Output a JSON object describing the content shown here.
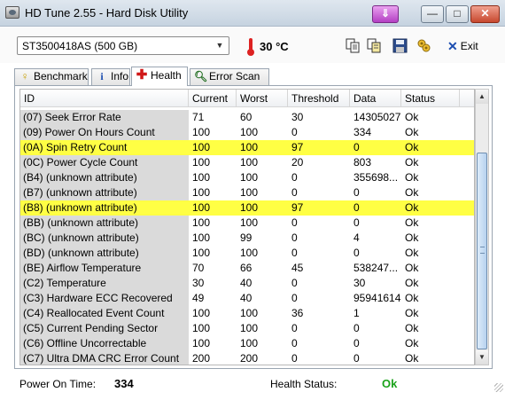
{
  "window": {
    "title": "HD Tune 2.55 - Hard Disk Utility",
    "controls": {
      "download": "⇓",
      "minimize": "—",
      "maximize": "□",
      "close": "✕"
    }
  },
  "toolbar": {
    "drive": "ST3500418AS (500 GB)",
    "temperature": "30 °C",
    "exit_label": "Exit",
    "icons": [
      "copy-icon",
      "copy-all-icon",
      "save-icon",
      "options-icon",
      "exit-icon"
    ]
  },
  "tabs": [
    {
      "label": "Benchmark",
      "icon": "gauge-icon",
      "active": false
    },
    {
      "label": "Info",
      "icon": "info-icon",
      "active": false
    },
    {
      "label": "Health",
      "icon": "health-cross-icon",
      "active": true
    },
    {
      "label": "Error Scan",
      "icon": "magnifier-icon",
      "active": false
    }
  ],
  "table": {
    "columns": [
      "ID",
      "Current",
      "Worst",
      "Threshold",
      "Data",
      "Status"
    ],
    "rows": [
      [
        "(07) Seek Error Rate",
        "71",
        "60",
        "30",
        "14305027",
        "Ok"
      ],
      [
        "(09) Power On Hours Count",
        "100",
        "100",
        "0",
        "334",
        "Ok"
      ],
      [
        "(0A) Spin Retry Count",
        "100",
        "100",
        "97",
        "0",
        "Ok"
      ],
      [
        "(0C) Power Cycle Count",
        "100",
        "100",
        "20",
        "803",
        "Ok"
      ],
      [
        "(B4) (unknown attribute)",
        "100",
        "100",
        "0",
        "355698...",
        "Ok"
      ],
      [
        "(B7) (unknown attribute)",
        "100",
        "100",
        "0",
        "0",
        "Ok"
      ],
      [
        "(B8) (unknown attribute)",
        "100",
        "100",
        "97",
        "0",
        "Ok"
      ],
      [
        "(BB) (unknown attribute)",
        "100",
        "100",
        "0",
        "0",
        "Ok"
      ],
      [
        "(BC) (unknown attribute)",
        "100",
        "99",
        "0",
        "4",
        "Ok"
      ],
      [
        "(BD) (unknown attribute)",
        "100",
        "100",
        "0",
        "0",
        "Ok"
      ],
      [
        "(BE) Airflow Temperature",
        "70",
        "66",
        "45",
        "538247...",
        "Ok"
      ],
      [
        "(C2) Temperature",
        "30",
        "40",
        "0",
        "30",
        "Ok"
      ],
      [
        "(C3) Hardware ECC Recovered",
        "49",
        "40",
        "0",
        "95941614",
        "Ok"
      ],
      [
        "(C4) Reallocated Event Count",
        "100",
        "100",
        "36",
        "1",
        "Ok"
      ],
      [
        "(C5) Current Pending Sector",
        "100",
        "100",
        "0",
        "0",
        "Ok"
      ],
      [
        "(C6) Offline Uncorrectable",
        "100",
        "100",
        "0",
        "0",
        "Ok"
      ],
      [
        "(C7) Ultra DMA CRC Error Count",
        "200",
        "200",
        "0",
        "0",
        "Ok"
      ]
    ],
    "highlighted_rows": [
      2,
      6
    ],
    "highlight_color": "#ffff44"
  },
  "status": {
    "power_on_label": "Power On Time:",
    "power_on_value": "334",
    "health_label": "Health Status:",
    "health_value": "Ok",
    "health_color": "#1ca31c"
  }
}
